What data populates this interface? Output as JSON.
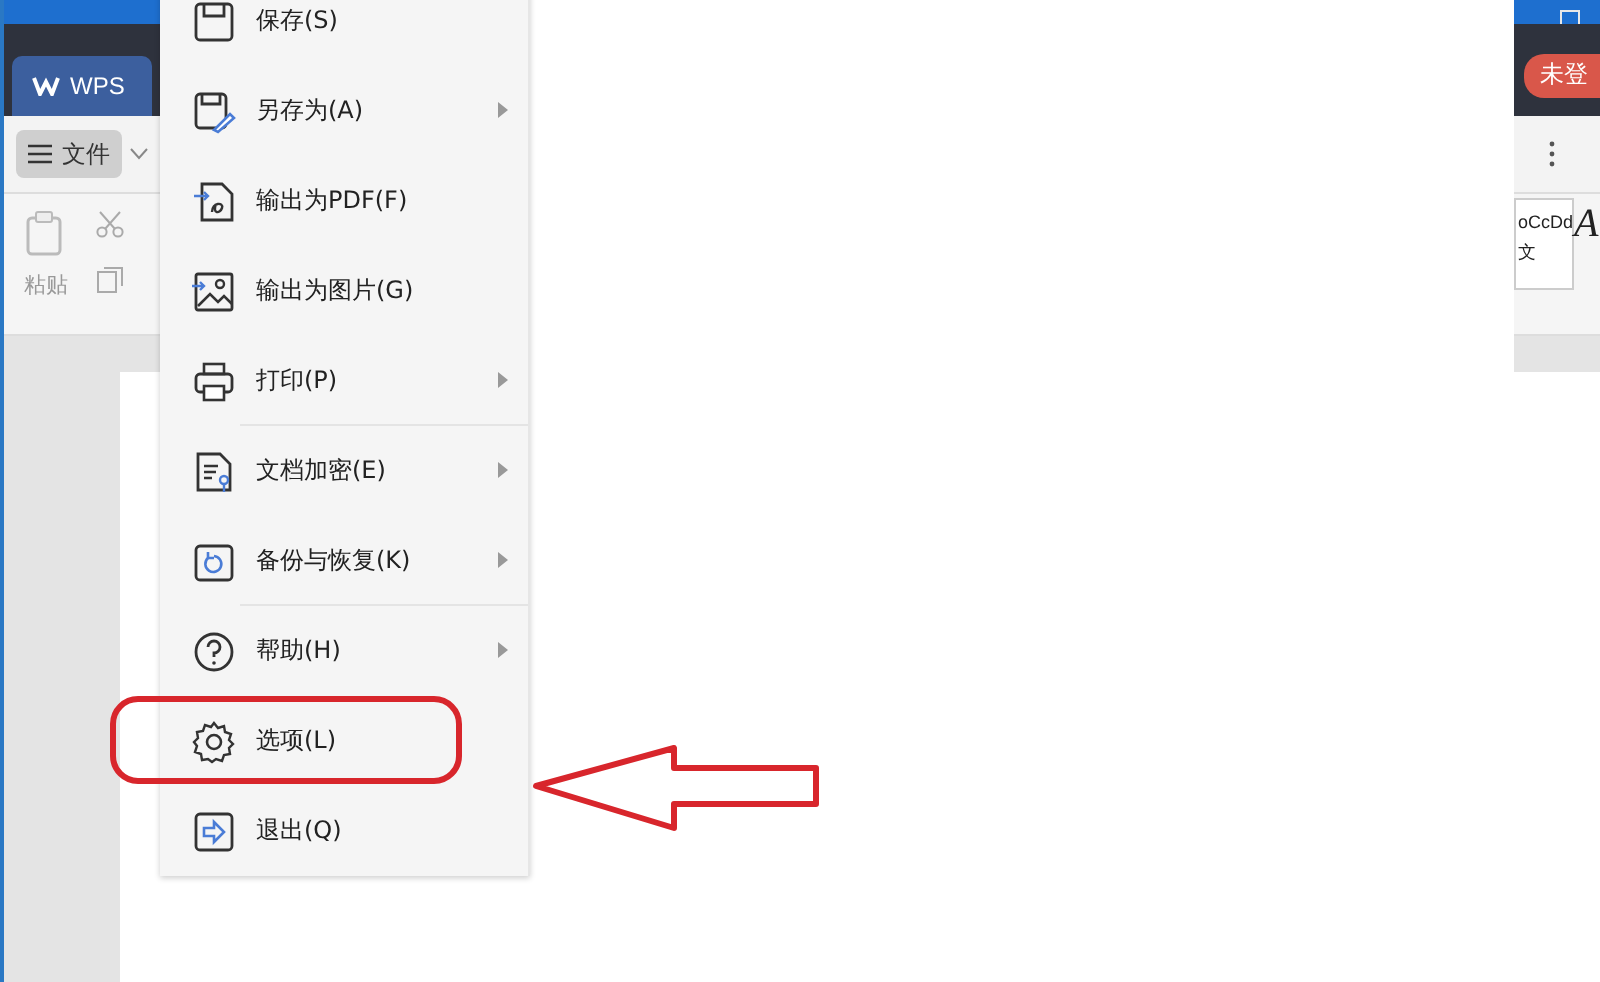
{
  "app": {
    "tab": "WPS",
    "file_button": "文件",
    "login_badge": "未登",
    "paste_label": "粘贴",
    "style_preview": "oCcDd",
    "style_char": "文",
    "style_big": "A"
  },
  "menu": {
    "items": [
      {
        "label": "保存(S)",
        "kind": "save",
        "submenu": false,
        "divider_after": false,
        "annotated": false
      },
      {
        "label": "另存为(A)",
        "kind": "save-as",
        "submenu": true,
        "divider_after": false,
        "annotated": false
      },
      {
        "label": "输出为PDF(F)",
        "kind": "pdf",
        "submenu": false,
        "divider_after": false,
        "annotated": false
      },
      {
        "label": "输出为图片(G)",
        "kind": "image",
        "submenu": false,
        "divider_after": false,
        "annotated": false
      },
      {
        "label": "打印(P)",
        "kind": "print",
        "submenu": true,
        "divider_after": true,
        "annotated": false
      },
      {
        "label": "文档加密(E)",
        "kind": "encrypt",
        "submenu": true,
        "divider_after": false,
        "annotated": false
      },
      {
        "label": "备份与恢复(K)",
        "kind": "backup",
        "submenu": true,
        "divider_after": true,
        "annotated": false
      },
      {
        "label": "帮助(H)",
        "kind": "help",
        "submenu": true,
        "divider_after": false,
        "annotated": false
      },
      {
        "label": "选项(L)",
        "kind": "options",
        "submenu": false,
        "divider_after": false,
        "annotated": true
      },
      {
        "label": "退出(Q)",
        "kind": "exit",
        "submenu": false,
        "divider_after": false,
        "annotated": false
      }
    ]
  }
}
